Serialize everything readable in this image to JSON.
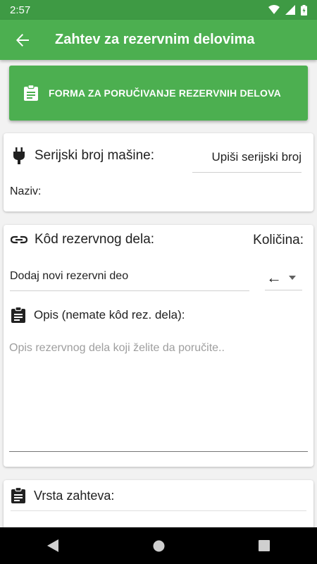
{
  "status_bar": {
    "time": "2:57"
  },
  "app_bar": {
    "title": "Zahtev za rezervnim delovima"
  },
  "banner": {
    "label": "FORMA ZA PORUČIVANJE REZERVNIH DELOVA"
  },
  "machine": {
    "serial_label": "Serijski broj mašine:",
    "serial_input": "Upiši serijski broj",
    "name_label": "Naziv:"
  },
  "part": {
    "code_label": "Kôd rezervnog dela:",
    "quantity_label": "Količina:",
    "add_part_input": "Dodaj novi rezervni deo",
    "quantity_value": "←",
    "description_label": "Opis (nemate kôd rez. dela):",
    "description_placeholder": "Opis rezervnog dela koji želite da poručite.."
  },
  "request": {
    "type_label": "Vrsta zahteva:"
  },
  "colors": {
    "primary": "#4caf50",
    "status_bar": "#3e9a44"
  }
}
